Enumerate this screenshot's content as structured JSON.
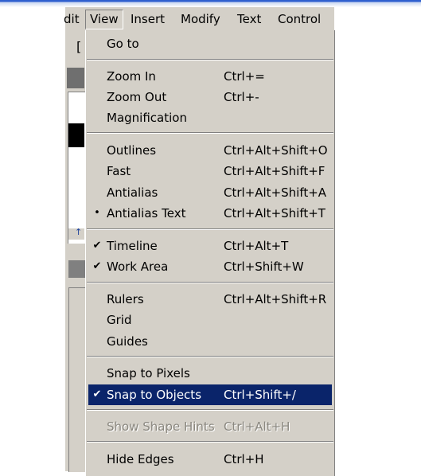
{
  "menubar": {
    "items": [
      {
        "label": "dit"
      },
      {
        "label": "View"
      },
      {
        "label": "Insert"
      },
      {
        "label": "Modify"
      },
      {
        "label": "Text"
      },
      {
        "label": "Control"
      }
    ]
  },
  "background": {
    "bracket_glyph": "[",
    "arrow_glyph": "↑"
  },
  "view_menu": {
    "items": [
      {
        "label": "Go to",
        "shortcut": "",
        "mark": ""
      },
      {
        "label": "Zoom In",
        "shortcut": "Ctrl+=",
        "mark": ""
      },
      {
        "label": "Zoom Out",
        "shortcut": "Ctrl+-",
        "mark": ""
      },
      {
        "label": "Magnification",
        "shortcut": "",
        "mark": ""
      },
      {
        "label": "Outlines",
        "shortcut": "Ctrl+Alt+Shift+O",
        "mark": ""
      },
      {
        "label": "Fast",
        "shortcut": "Ctrl+Alt+Shift+F",
        "mark": ""
      },
      {
        "label": "Antialias",
        "shortcut": "Ctrl+Alt+Shift+A",
        "mark": ""
      },
      {
        "label": "Antialias Text",
        "shortcut": "Ctrl+Alt+Shift+T",
        "mark": "•"
      },
      {
        "label": "Timeline",
        "shortcut": "Ctrl+Alt+T",
        "mark": "✔"
      },
      {
        "label": "Work Area",
        "shortcut": "Ctrl+Shift+W",
        "mark": "✔"
      },
      {
        "label": "Rulers",
        "shortcut": "Ctrl+Alt+Shift+R",
        "mark": ""
      },
      {
        "label": "Grid",
        "shortcut": "",
        "mark": ""
      },
      {
        "label": "Guides",
        "shortcut": "",
        "mark": ""
      },
      {
        "label": "Snap to Pixels",
        "shortcut": "",
        "mark": ""
      },
      {
        "label": "Snap to Objects",
        "shortcut": "Ctrl+Shift+/",
        "mark": "✔"
      },
      {
        "label": "Show Shape Hints",
        "shortcut": "Ctrl+Alt+H",
        "mark": ""
      },
      {
        "label": "Hide Edges",
        "shortcut": "Ctrl+H",
        "mark": ""
      }
    ]
  },
  "colors": {
    "menu_bg": "#d4d0c8",
    "highlight": "#0a246a",
    "title_blue": "#2f5fcf"
  }
}
